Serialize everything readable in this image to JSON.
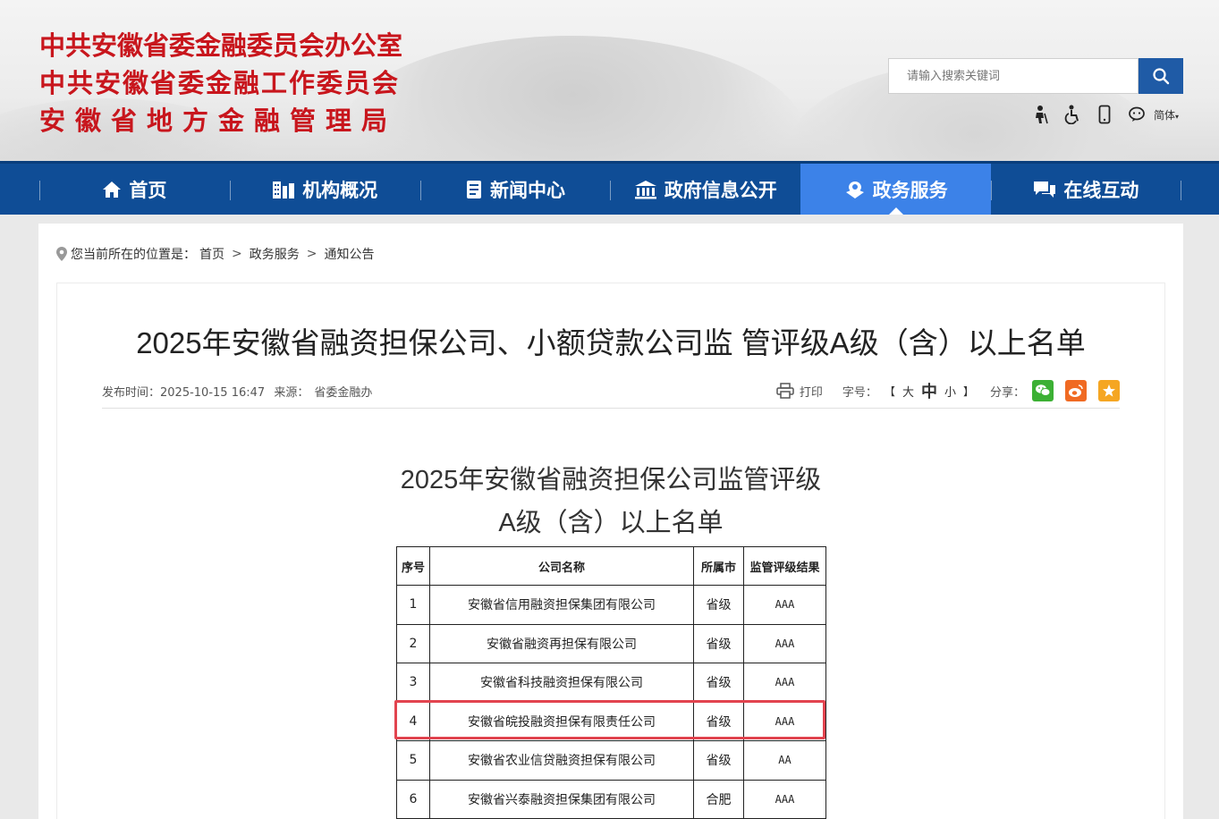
{
  "header": {
    "titles": [
      "中共安徽省委金融委员会办公室",
      "中共安徽省委金融工作委员会",
      "安徽省地方金融管理局"
    ],
    "search_placeholder": "请输入搜索关键词",
    "lang_label": "简体",
    "tool_icons": [
      "elderly-mode-icon",
      "accessibility-icon",
      "mobile-icon",
      "wechat-icon"
    ]
  },
  "nav": {
    "items": [
      {
        "label": "首页",
        "icon": "home-icon"
      },
      {
        "label": "机构概况",
        "icon": "building-icon"
      },
      {
        "label": "新闻中心",
        "icon": "news-icon"
      },
      {
        "label": "政府信息公开",
        "icon": "government-icon"
      },
      {
        "label": "政务服务",
        "icon": "service-icon"
      },
      {
        "label": "在线互动",
        "icon": "chat-icon"
      }
    ],
    "active": "政务服务"
  },
  "breadcrumb": {
    "prefix": "您当前所在的位置是：",
    "items": [
      "首页",
      "政务服务",
      "通知公告"
    ],
    "separator": ">"
  },
  "article": {
    "title": "2025年安徽省融资担保公司、小额贷款公司监 管评级A级（含）以上名单",
    "publish_label": "发布时间：",
    "publish_time": "2025-10-15 16:47",
    "source_label": "来源：",
    "source": "省委金融办",
    "print_label": "打印",
    "font_label": "字号：",
    "font_open": "【",
    "font_large": "大",
    "font_medium": "中",
    "font_small": "小",
    "font_close": "】",
    "share_label": "分享："
  },
  "document": {
    "title_line1": "2025年安徽省融资担保公司监管评级",
    "title_line2": "A级（含）以上名单"
  },
  "table": {
    "headers": [
      "序号",
      "公司名称",
      "所属市",
      "监管评级结果"
    ],
    "rows": [
      {
        "index": "1",
        "name": "安徽省信用融资担保集团有限公司",
        "city": "省级",
        "rating": "AAA"
      },
      {
        "index": "2",
        "name": "安徽省融资再担保有限公司",
        "city": "省级",
        "rating": "AAA"
      },
      {
        "index": "3",
        "name": "安徽省科技融资担保有限公司",
        "city": "省级",
        "rating": "AAA"
      },
      {
        "index": "4",
        "name": "安徽省皖投融资担保有限责任公司",
        "city": "省级",
        "rating": "AAA"
      },
      {
        "index": "5",
        "name": "安徽省农业信贷融资担保有限公司",
        "city": "省级",
        "rating": "AA"
      },
      {
        "index": "6",
        "name": "安徽省兴泰融资担保集团有限公司",
        "city": "合肥",
        "rating": "AAA"
      }
    ],
    "highlighted_row": "4"
  },
  "colors": {
    "title_red": "#c8161d",
    "nav_blue": "#0f4d96",
    "nav_active": "#3c82e8",
    "highlight": "#e2444f"
  }
}
